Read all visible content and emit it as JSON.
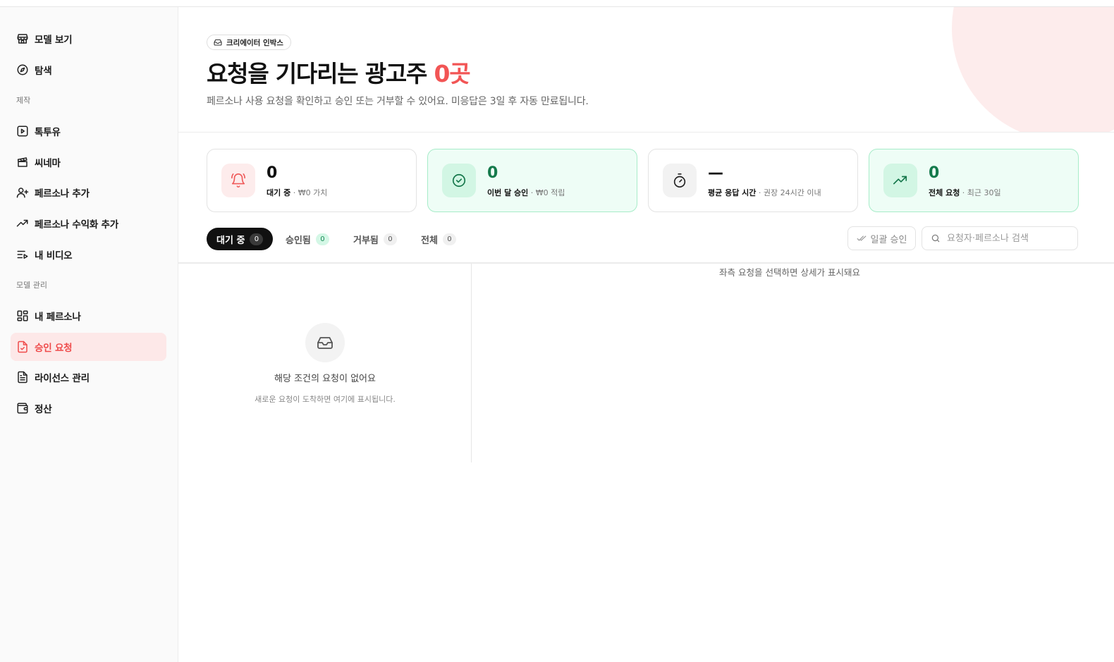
{
  "sidebar": {
    "top_items": [
      {
        "label": "모델 보기",
        "icon": "store-icon"
      },
      {
        "label": "탐색",
        "icon": "compass-icon"
      }
    ],
    "sections": [
      {
        "label": "제작",
        "items": [
          {
            "label": "톡투유",
            "icon": "play-square-icon"
          },
          {
            "label": "씨네마",
            "icon": "clapperboard-icon"
          },
          {
            "label": "페르소나 추가",
            "icon": "user-plus-icon"
          },
          {
            "label": "페르소나 수익화 추가",
            "icon": "trending-up-icon"
          },
          {
            "label": "내 비디오",
            "icon": "list-video-icon"
          }
        ]
      },
      {
        "label": "모델 관리",
        "items": [
          {
            "label": "내 페르소나",
            "icon": "layout-grid-icon"
          },
          {
            "label": "승인 요청",
            "icon": "file-check-icon",
            "active": true
          },
          {
            "label": "라이선스 관리",
            "icon": "file-text-icon"
          },
          {
            "label": "정산",
            "icon": "wallet-icon"
          }
        ]
      }
    ],
    "active_color": "#ef4b4b"
  },
  "hero": {
    "badge": "크리에이터 인박스",
    "title_prefix": "요청을 기다리는 광고주 ",
    "title_accent": "0곳",
    "subtitle": "페르소나 사용 요청을 확인하고 승인 또는 거부할 수 있어요. 미응답은 3일 후 자동 만료됩니다.",
    "accent_color": "#f25555"
  },
  "stats": [
    {
      "value": "0",
      "label": "대기 중",
      "detail": " · ₩0 가치",
      "icon": "bell-ring-icon",
      "variant": "plain"
    },
    {
      "value": "0",
      "label": "이번 달 승인",
      "detail": " · ₩0 적립",
      "icon": "check-circle-icon",
      "variant": "green"
    },
    {
      "value": "—",
      "label": "평균 응답 시간",
      "detail": " · 권장 24시간 이내",
      "icon": "timer-icon",
      "variant": "plain"
    },
    {
      "value": "0",
      "label": "전체 요청",
      "detail": " · 최근 30일",
      "icon": "trending-up-icon",
      "variant": "green"
    }
  ],
  "tabs": [
    {
      "label": "대기 중",
      "count": "0",
      "active": true
    },
    {
      "label": "승인됨",
      "count": "0",
      "variant": "green"
    },
    {
      "label": "거부됨",
      "count": "0"
    },
    {
      "label": "전체",
      "count": "0"
    }
  ],
  "toolbar": {
    "bulk_approve_label": "일괄 승인",
    "search_placeholder": "요청자·페르소나 검색"
  },
  "list": {
    "empty_title": "해당 조건의 요청이 없어요",
    "empty_subtitle": "새로운 요청이 도착하면 여기에 표시됩니다."
  },
  "detail": {
    "hint": "좌측 요청을 선택하면 상세가 표시돼요"
  }
}
